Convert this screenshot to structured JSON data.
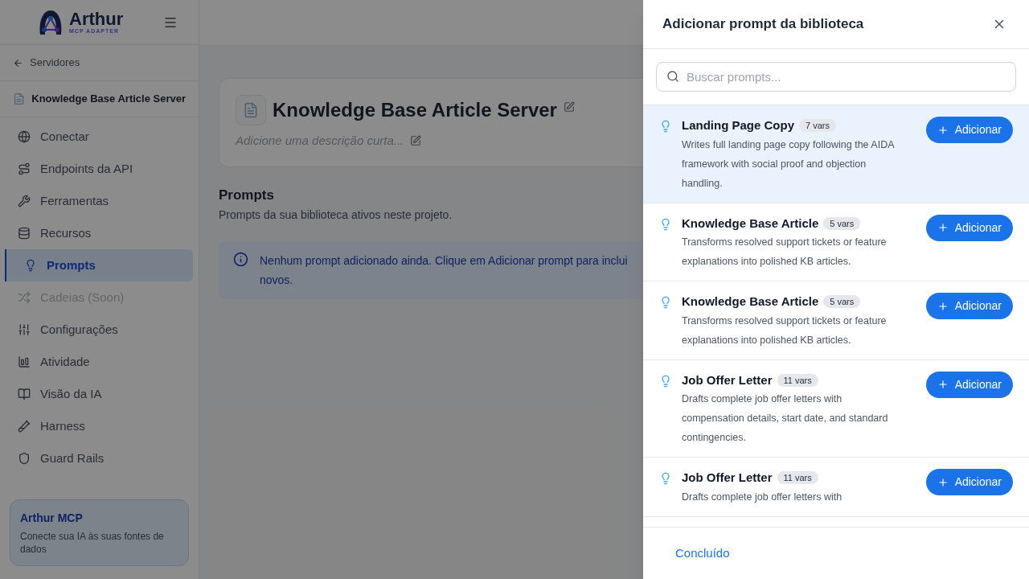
{
  "sidebar": {
    "logo": {
      "name": "Arthur",
      "tagline": "MCP ADAPTER"
    },
    "back_link": "Servidores",
    "server": "Knowledge Base Article Server",
    "items": [
      {
        "label": "Conectar",
        "selected": false,
        "disabled": false
      },
      {
        "label": "Endpoints da API",
        "selected": false,
        "disabled": false
      },
      {
        "label": "Ferramentas",
        "selected": false,
        "disabled": false
      },
      {
        "label": "Recursos",
        "selected": false,
        "disabled": false
      },
      {
        "label": "Prompts",
        "selected": true,
        "disabled": false
      },
      {
        "label": "Cadeias (Soon)",
        "selected": false,
        "disabled": true
      },
      {
        "label": "Configurações",
        "selected": false,
        "disabled": false
      },
      {
        "label": "Atividade",
        "selected": false,
        "disabled": false
      },
      {
        "label": "Visão da IA",
        "selected": false,
        "disabled": false
      },
      {
        "label": "Harness",
        "selected": false,
        "disabled": false
      },
      {
        "label": "Guard Rails",
        "selected": false,
        "disabled": false
      }
    ],
    "promo": {
      "title": "Arthur MCP",
      "text": "Conecte sua IA às suas fontes de dados"
    }
  },
  "main": {
    "title": "Knowledge Base Article Server",
    "description_placeholder": "Adicione uma descrição curta...",
    "section_title": "Prompts",
    "section_subtitle": "Prompts da sua biblioteca ativos neste projeto.",
    "info_lines": [
      "Nenhum prompt adicionado ainda. Clique em Adicionar prompt para inclui",
      "novos."
    ]
  },
  "drawer": {
    "title": "Adicionar prompt da biblioteca",
    "search": {
      "placeholder": "Buscar prompts..."
    },
    "prompts": [
      {
        "name": "Landing Page Copy",
        "vars": "7 vars",
        "description": "Writes full landing page copy following the AIDA framework with social proof and objection handling.",
        "button": "Adicionar",
        "highlighted": true
      },
      {
        "name": "Knowledge Base Article",
        "vars": "5 vars",
        "description": "Transforms resolved support tickets or feature explanations into polished KB articles.",
        "button": "Adicionar",
        "highlighted": false
      },
      {
        "name": "Knowledge Base Article",
        "vars": "5 vars",
        "description": "Transforms resolved support tickets or feature explanations into polished KB articles.",
        "button": "Adicionar",
        "highlighted": false
      },
      {
        "name": "Job Offer Letter",
        "vars": "11 vars",
        "description": "Drafts complete job offer letters with compensation details, start date, and standard contingencies.",
        "button": "Adicionar",
        "highlighted": false
      },
      {
        "name": "Job Offer Letter",
        "vars": "11 vars",
        "description": "Drafts complete job offer letters with",
        "button": "Adicionar",
        "highlighted": false
      }
    ],
    "done": "Concluído"
  }
}
